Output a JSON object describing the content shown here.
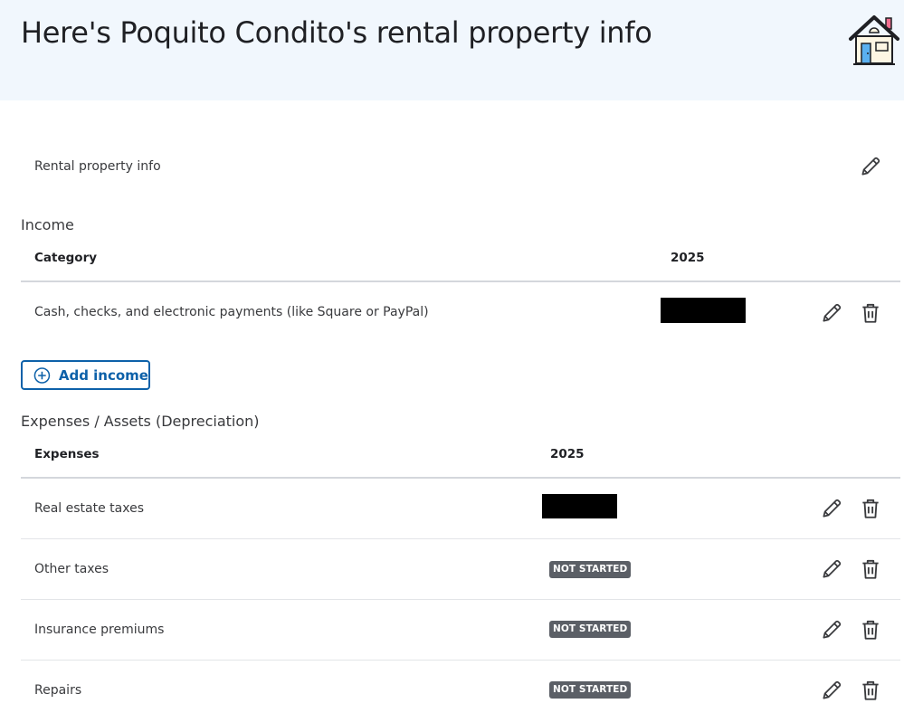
{
  "header": {
    "title": "Here's Poquito Condito's rental property info",
    "icon": "house-icon"
  },
  "property_info": {
    "label": "Rental property info"
  },
  "income": {
    "section_title": "Income",
    "columns": [
      "Category",
      "2025"
    ],
    "rows": [
      {
        "label": "Cash, checks, and electronic payments (like Square or PayPal)",
        "value": "",
        "redacted": true
      }
    ],
    "add_button_label": "Add income"
  },
  "expenses": {
    "section_title": "Expenses / Assets (Depreciation)",
    "columns": [
      "Expenses",
      "2025"
    ],
    "rows": [
      {
        "label": "Real estate taxes",
        "redacted": true,
        "status": ""
      },
      {
        "label": "Other taxes",
        "redacted": false,
        "status": "NOT STARTED"
      },
      {
        "label": "Insurance premiums",
        "redacted": false,
        "status": "NOT STARTED"
      },
      {
        "label": "Repairs",
        "redacted": false,
        "status": "NOT STARTED"
      }
    ]
  },
  "colors": {
    "header_bg": "#f1f7fd",
    "accent": "#0d61a9",
    "badge_bg": "#5b5f66",
    "text": "#393a3d"
  }
}
